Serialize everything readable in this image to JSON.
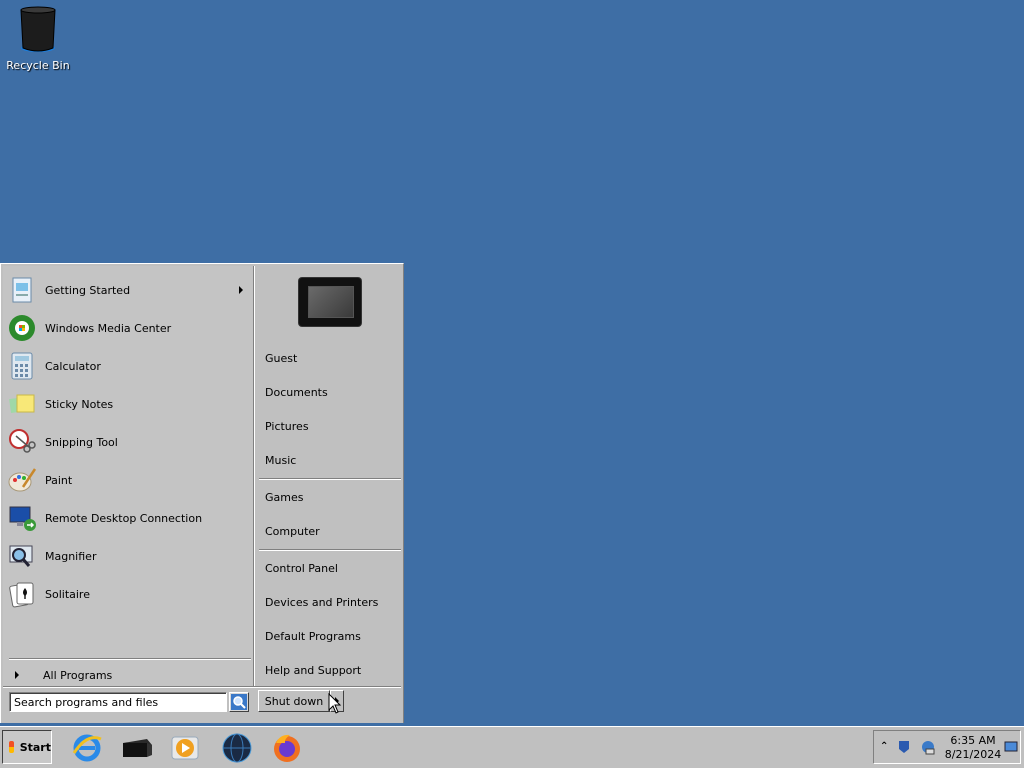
{
  "desktop": {
    "icons": [
      {
        "label": "Recycle Bin",
        "icon": "recycle-bin-icon"
      }
    ]
  },
  "start_menu": {
    "programs": [
      {
        "label": "Getting Started",
        "icon": "getting-started-icon",
        "has_submenu": true
      },
      {
        "label": "Windows Media Center",
        "icon": "media-center-icon"
      },
      {
        "label": "Calculator",
        "icon": "calculator-icon"
      },
      {
        "label": "Sticky Notes",
        "icon": "sticky-notes-icon"
      },
      {
        "label": "Snipping Tool",
        "icon": "snipping-tool-icon"
      },
      {
        "label": "Paint",
        "icon": "paint-icon"
      },
      {
        "label": "Remote Desktop Connection",
        "icon": "remote-desktop-icon"
      },
      {
        "label": "Magnifier",
        "icon": "magnifier-icon"
      },
      {
        "label": "Solitaire",
        "icon": "solitaire-icon"
      }
    ],
    "all_programs": "All Programs",
    "right_items": {
      "group1": [
        "Guest",
        "Documents",
        "Pictures",
        "Music"
      ],
      "group2": [
        "Games",
        "Computer"
      ],
      "group3": [
        "Control Panel",
        "Devices and Printers",
        "Default Programs",
        "Help and Support"
      ]
    },
    "search": {
      "placeholder": "Search programs and files"
    },
    "shutdown_label": "Shut down"
  },
  "taskbar": {
    "start_label": "Start",
    "pinned": [
      {
        "name": "internet-explorer-icon"
      },
      {
        "name": "terminal-icon"
      },
      {
        "name": "media-player-icon"
      },
      {
        "name": "globe-icon"
      },
      {
        "name": "firefox-icon"
      }
    ],
    "tray": {
      "time": "6:35 AM",
      "date": "8/21/2024"
    }
  }
}
